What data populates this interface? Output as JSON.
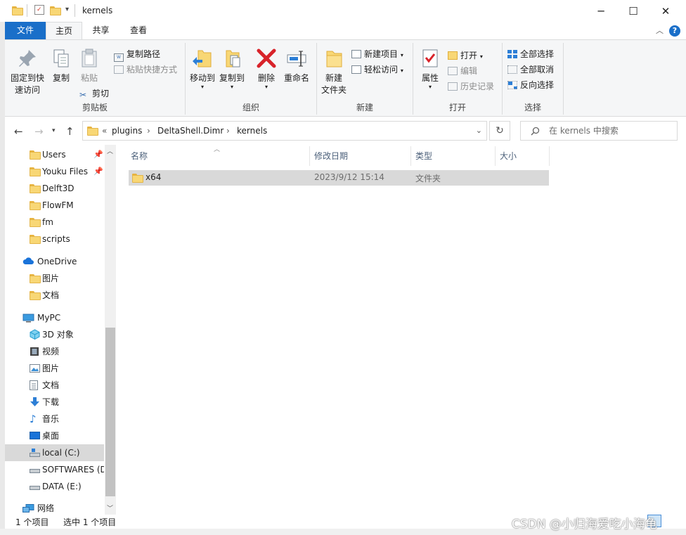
{
  "window": {
    "title": "kernels",
    "minimize": "─",
    "maximize": "☐",
    "close": "✕"
  },
  "tabs": {
    "file": "文件",
    "home": "主页",
    "share": "共享",
    "view": "查看"
  },
  "ribbon": {
    "clipboard": {
      "label": "剪贴板",
      "pin": "固定到快\n速访问",
      "pin_line1": "固定到快",
      "pin_line2": "速访问",
      "copy": "复制",
      "paste": "粘贴",
      "copy_path": "复制路径",
      "paste_shortcut": "粘贴快捷方式",
      "cut": "剪切"
    },
    "organize": {
      "label": "组织",
      "move_to": "移动到",
      "copy_to": "复制到",
      "delete": "删除",
      "rename": "重命名"
    },
    "new": {
      "label": "新建",
      "new_folder_line1": "新建",
      "new_folder_line2": "文件夹",
      "new_item": "新建项目",
      "easy_access": "轻松访问"
    },
    "open": {
      "label": "打开",
      "properties": "属性",
      "open": "打开",
      "edit": "编辑",
      "history": "历史记录"
    },
    "select": {
      "label": "选择",
      "select_all": "全部选择",
      "select_none": "全部取消",
      "invert": "反向选择"
    }
  },
  "address": {
    "overflow": "«",
    "crumbs": [
      "plugins",
      "DeltaShell.Dimr",
      "kernels"
    ],
    "separator": "›",
    "search_placeholder": "在 kernels 中搜索"
  },
  "nav": {
    "quick_access": [
      "Users",
      "Youku Files",
      "Delft3D",
      "FlowFM",
      "fm",
      "scripts"
    ],
    "onedrive": "OneDrive",
    "onedrive_items": [
      "图片",
      "文档"
    ],
    "mypc": "MyPC",
    "mypc_items": [
      "3D 对象",
      "视频",
      "图片",
      "文档",
      "下载",
      "音乐",
      "桌面"
    ],
    "drives": [
      "local (C:)",
      "SOFTWARES (D",
      "DATA (E:)"
    ],
    "network": "网络"
  },
  "files": {
    "columns": [
      "名称",
      "修改日期",
      "类型",
      "大小"
    ],
    "rows": [
      {
        "name": "x64",
        "modified": "2023/9/12 15:14",
        "type": "文件夹",
        "size": ""
      }
    ]
  },
  "status": {
    "count": "1 个项目",
    "selected": "选中 1 个项目"
  },
  "watermark": "CSDN @小归海爱吃小海龟",
  "colors": {
    "accent": "#1a6fc9",
    "folder": "#f8d775",
    "selection": "#d9d9d9"
  }
}
